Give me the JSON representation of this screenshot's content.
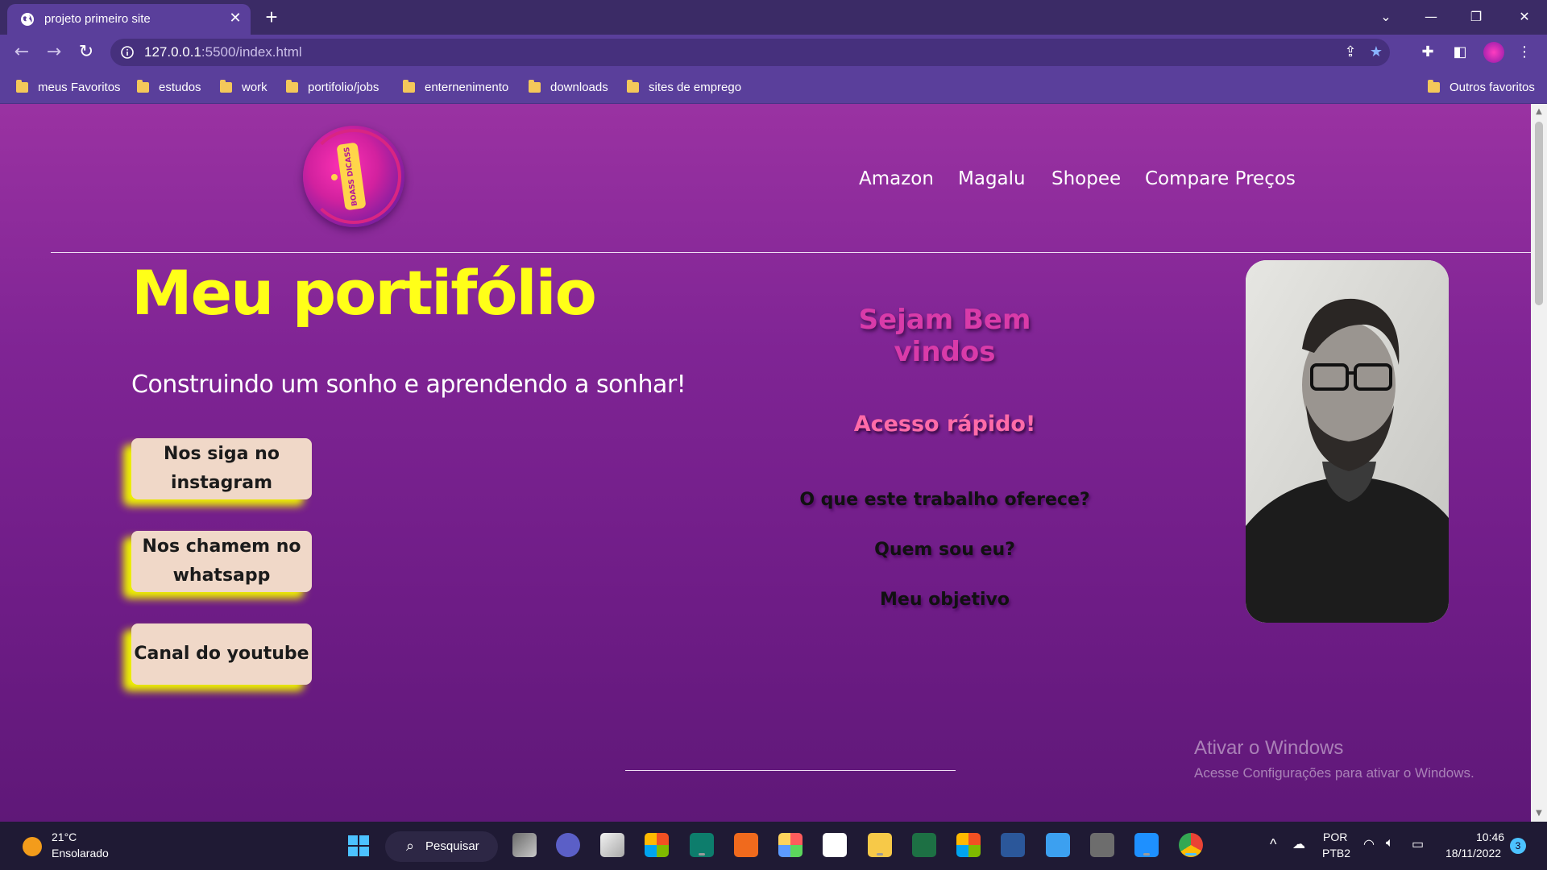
{
  "browser": {
    "tab_title": "projeto primeiro site",
    "url_host": "127.0.0.1",
    "url_rest": ":5500/index.html",
    "bookmarks": [
      "meus Favoritos",
      "estudos",
      "work",
      "portifolio/jobs",
      "enternenimento",
      "downloads",
      "sites de emprego"
    ],
    "other_bookmarks": "Outros favoritos"
  },
  "page": {
    "logo_text": "BOASS DICASS",
    "nav": [
      "Amazon",
      "Magalu",
      "Shopee",
      "Compare Preços"
    ],
    "title": "Meu portifólio",
    "subtitle": "Construindo um sonho e aprendendo a sonhar!",
    "buttons": [
      {
        "line1": "Nos siga no",
        "line2": "instagram"
      },
      {
        "line1": "Nos chamem no",
        "line2": "whatsapp"
      },
      {
        "line1": "Canal do youtube",
        "line2": ""
      }
    ],
    "welcome": "Sejam Bem vindos",
    "quick_access": "Acesso rápido!",
    "quick_links": [
      "O que este trabalho oferece?",
      "Quem sou eu?",
      "Meu objetivo"
    ]
  },
  "watermark": {
    "line1": "Ativar o Windows",
    "line2": "Acesse Configurações para ativar o Windows."
  },
  "taskbar": {
    "temp": "21°C",
    "weather": "Ensolarado",
    "search_label": "Pesquisar",
    "lang1": "POR",
    "lang2": "PTB2",
    "time": "10:46",
    "date": "18/11/2022",
    "notification_count": "3"
  },
  "colors": {
    "title_yellow": "#ffff18",
    "button_bg": "#f0d8c8",
    "button_glow": "#eff200",
    "welcome_pink": "#d93ba9",
    "quick_pink": "#ff6ba8",
    "chrome_purple": "#5a3f9b"
  }
}
